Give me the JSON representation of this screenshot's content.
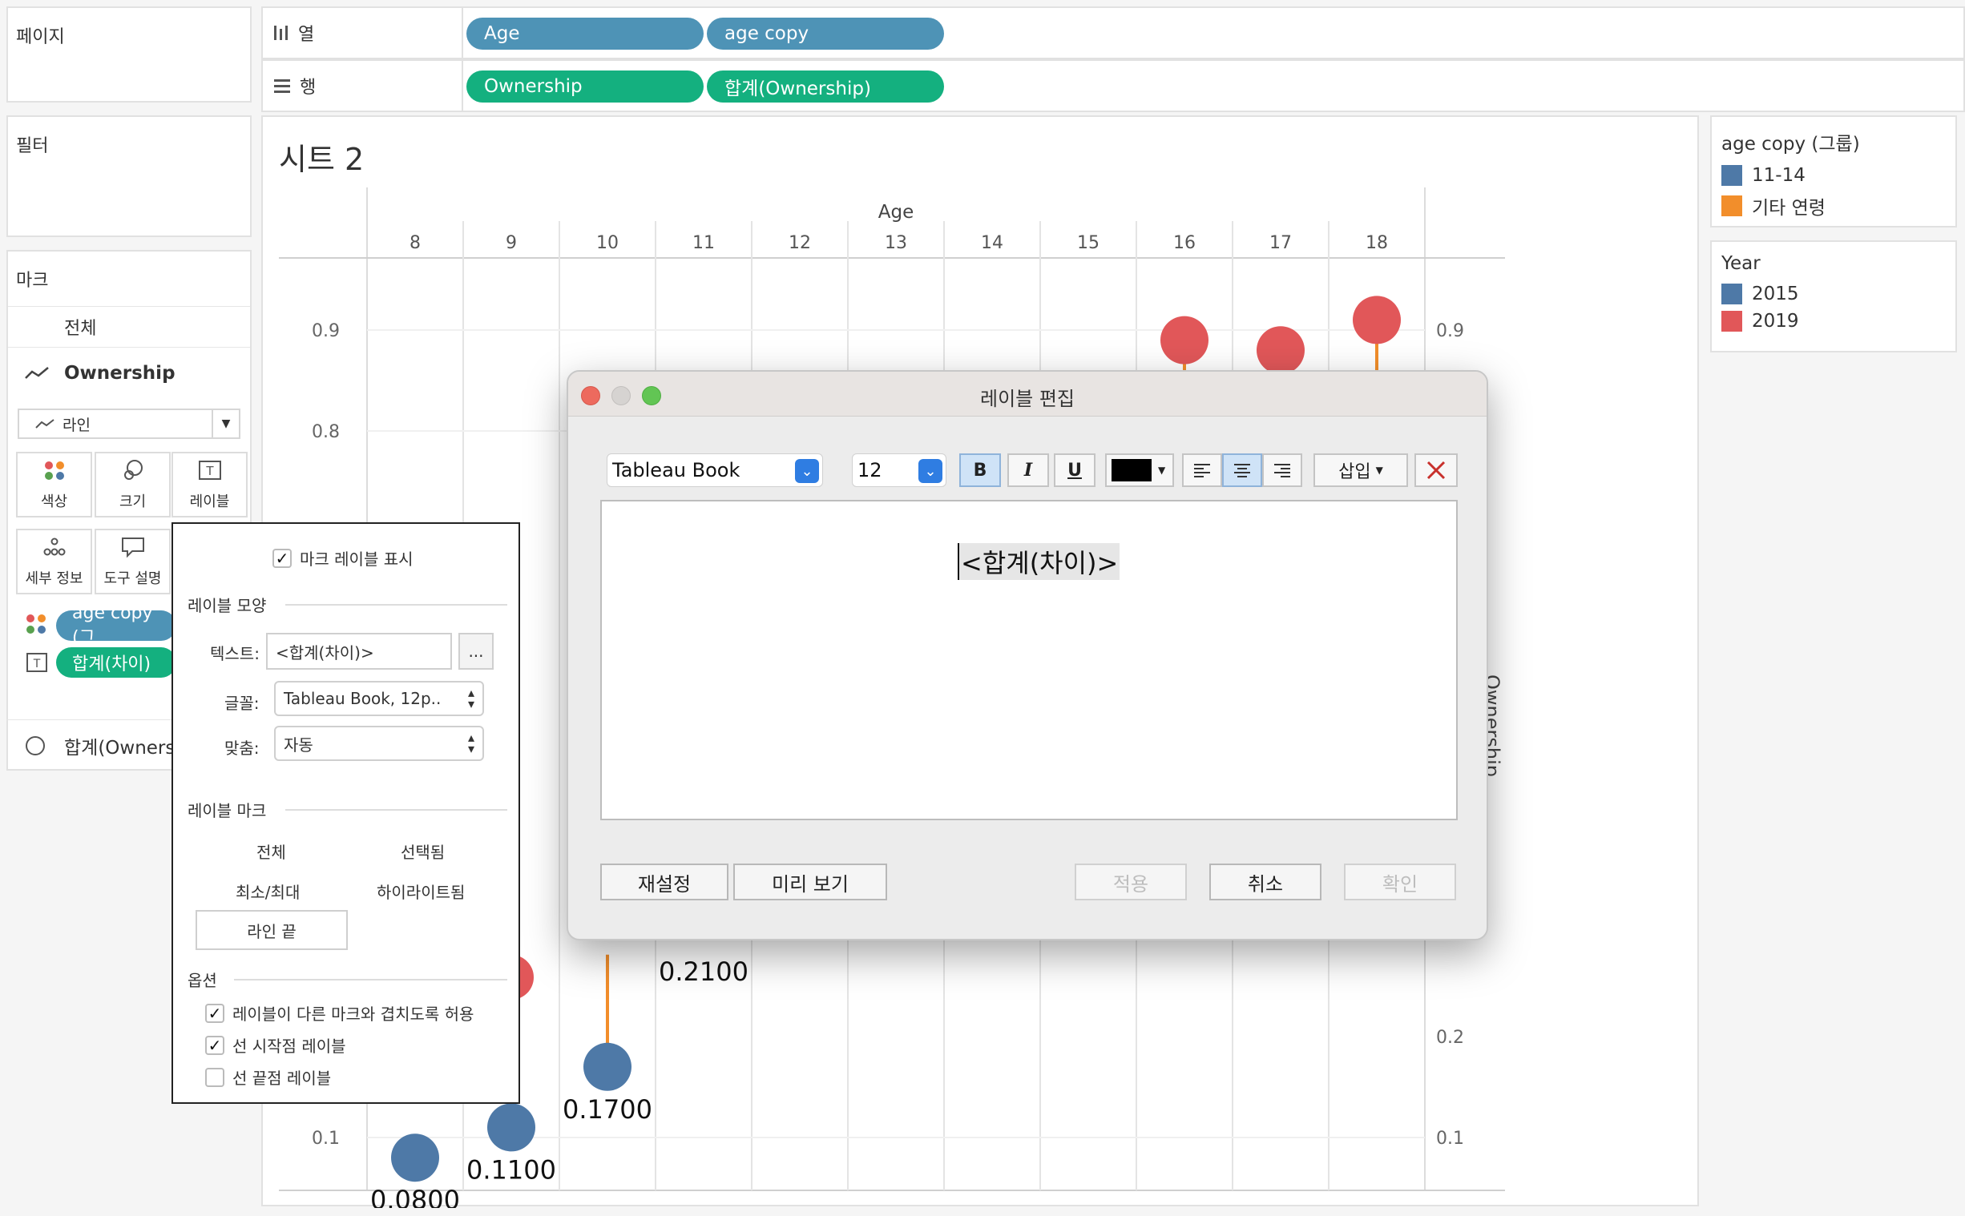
{
  "left_panel": {
    "pages_title": "페이지",
    "filters_title": "필터",
    "marks_title": "마크",
    "marks_all": "전체",
    "marks_ownership": "Ownership",
    "mark_type": "라인",
    "tiles": {
      "color": "색상",
      "size": "크기",
      "label": "레이블",
      "detail": "세부 정보",
      "tooltip": "도구 설명"
    },
    "mark_pills": {
      "color_pill": "age copy (그",
      "label_pill": "합계(차이)"
    },
    "sum_ownership": "합계(Owners"
  },
  "shelves": {
    "columns_label": "열",
    "rows_label": "행",
    "columns_pills": [
      "Age",
      "age copy"
    ],
    "rows_pills": [
      "Ownership",
      "합계(Ownership)"
    ]
  },
  "sheet_title": "시트 2",
  "right_axis_title": "Ownership",
  "chart_data": {
    "type": "scatter",
    "x_title": "Age",
    "x_categories": [
      "8",
      "9",
      "10",
      "11",
      "12",
      "13",
      "14",
      "15",
      "16",
      "17",
      "18"
    ],
    "y_ticks_left": [
      "0.9",
      "0.8",
      "0.1"
    ],
    "y_ticks_right": [
      "0.9",
      "0.2",
      "0.1"
    ],
    "ylim": [
      0,
      1
    ],
    "series": [
      {
        "name": "2015",
        "points": [
          {
            "x": "8",
            "y": 0.08,
            "label": "0.0800"
          },
          {
            "x": "9",
            "y": 0.11,
            "label": "0.1100"
          },
          {
            "x": "10",
            "y": 0.17,
            "label": "0.1700"
          },
          {
            "x": "11",
            "label": "0.2100"
          }
        ]
      },
      {
        "name": "2019",
        "points": [
          {
            "x": "16",
            "y": 0.89
          },
          {
            "x": "17",
            "y": 0.88
          },
          {
            "x": "18",
            "y": 0.91
          }
        ]
      }
    ]
  },
  "legends": {
    "age_title": "age copy (그룹)",
    "age_items": [
      {
        "label": "11-14",
        "color": "#4e79a7"
      },
      {
        "label": "기타 연령",
        "color": "#f28e2b"
      }
    ],
    "year_title": "Year",
    "year_items": [
      {
        "label": "2015",
        "color": "#4e79a7"
      },
      {
        "label": "2019",
        "color": "#e15759"
      }
    ]
  },
  "label_popup": {
    "show_labels": "마크 레이블 표시",
    "appearance_title": "레이블 모양",
    "text_label": "텍스트:",
    "text_value": "<합계(차이)>",
    "more_button": "...",
    "font_label": "글꼴:",
    "font_value": "Tableau Book, 12p..",
    "align_label": "맞춤:",
    "align_value": "자동",
    "marks_title": "레이블 마크",
    "opt_all": "전체",
    "opt_selected": "선택됨",
    "opt_minmax": "최소/최대",
    "opt_highlighted": "하이라이트됨",
    "opt_line_ends": "라인 끝",
    "options_title": "옵션",
    "allow_overlap": "레이블이 다른 마크와 겹치도록 허용",
    "label_start": "선 시작점 레이블",
    "label_end": "선 끝점 레이블"
  },
  "dialog": {
    "title": "레이블 편집",
    "font": "Tableau Book",
    "size": "12",
    "bold": "B",
    "italic": "I",
    "underline": "U",
    "insert": "삽입",
    "editor_text": "<합계(차이)>",
    "reset": "재설정",
    "preview": "미리 보기",
    "apply": "적용",
    "cancel": "취소",
    "ok": "확인"
  }
}
